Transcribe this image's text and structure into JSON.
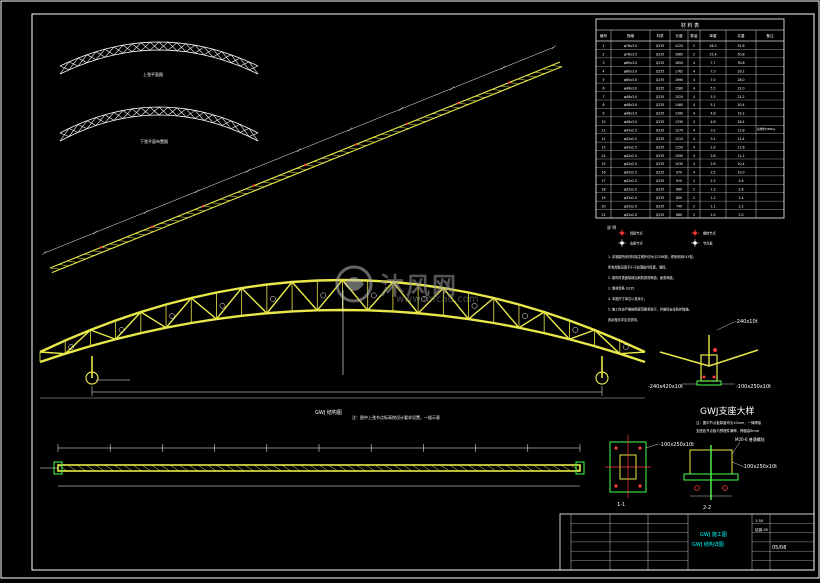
{
  "drawing": {
    "main_label": "GWJ 结构图",
    "main_note": "注：图中上弦节点标高按设计要求设置，一榀示意",
    "detail_title": "GWJ支座大样",
    "plan_label": "GWJ 平面图",
    "small_label_1": "上弦平面图",
    "small_label_2": "下弦平面布置图",
    "section_1": "1-1",
    "section_2": "2-2",
    "detail_callouts": [
      "-240x10t",
      "-240x420x10t",
      "-100x250x10t",
      "-100x250x10t",
      "-100x250x10t",
      "M20-6 普通螺栓"
    ],
    "detail_notes": [
      "注：图中节点板厚度均为10mm，一律焊接",
      "支座处节点板与预埋件满焊，焊缝高8mm"
    ]
  },
  "bom": {
    "title": "材  料  表",
    "headers": [
      "编号",
      "规格",
      "材质",
      "长度",
      "数量",
      "单重",
      "共重",
      "备注"
    ],
    "rows": [
      [
        "1",
        "φ76x3.5",
        "Q235",
        "4120",
        "2",
        "26.3",
        "52.6",
        ""
      ],
      [
        "2",
        "φ76x3.5",
        "Q235",
        "3985",
        "2",
        "25.4",
        "50.8",
        ""
      ],
      [
        "3",
        "φ60x3.0",
        "Q235",
        "1850",
        "4",
        "7.7",
        "30.8",
        ""
      ],
      [
        "4",
        "φ60x3.0",
        "Q235",
        "1762",
        "4",
        "7.3",
        "29.2",
        ""
      ],
      [
        "5",
        "φ60x3.0",
        "Q235",
        "1690",
        "4",
        "7.0",
        "28.0",
        ""
      ],
      [
        "6",
        "φ48x3.0",
        "Q235",
        "1580",
        "4",
        "5.5",
        "22.0",
        ""
      ],
      [
        "7",
        "φ48x3.0",
        "Q235",
        "1520",
        "4",
        "5.3",
        "21.2",
        ""
      ],
      [
        "8",
        "φ48x3.0",
        "Q235",
        "1460",
        "4",
        "5.1",
        "20.4",
        ""
      ],
      [
        "9",
        "φ48x3.0",
        "Q235",
        "1390",
        "4",
        "4.8",
        "19.2",
        ""
      ],
      [
        "10",
        "φ48x3.0",
        "Q235",
        "1330",
        "4",
        "4.6",
        "18.4",
        ""
      ],
      [
        "11",
        "φ42x2.5",
        "Q235",
        "1270",
        "4",
        "3.2",
        "12.8",
        ""
      ],
      [
        "12",
        "φ42x2.5",
        "Q235",
        "1210",
        "4",
        "3.1",
        "12.4",
        ""
      ],
      [
        "13",
        "φ42x2.5",
        "Q235",
        "1150",
        "4",
        "2.9",
        "11.6",
        ""
      ],
      [
        "14",
        "φ42x2.5",
        "Q235",
        "1090",
        "4",
        "2.8",
        "11.2",
        ""
      ],
      [
        "15",
        "φ42x2.5",
        "Q235",
        "1030",
        "4",
        "2.6",
        "10.4",
        ""
      ],
      [
        "16",
        "φ42x2.5",
        "Q235",
        "970",
        "4",
        "2.5",
        "10.0",
        ""
      ],
      [
        "17",
        "φ42x2.5",
        "Q235",
        "910",
        "2",
        "2.3",
        "4.6",
        ""
      ],
      [
        "18",
        "φ32x2.0",
        "Q235",
        "860",
        "2",
        "1.3",
        "2.6",
        ""
      ],
      [
        "19",
        "φ32x2.0",
        "Q235",
        "800",
        "2",
        "1.2",
        "2.4",
        ""
      ],
      [
        "20",
        "φ32x2.0",
        "Q235",
        "740",
        "2",
        "1.1",
        "2.2",
        ""
      ],
      [
        "21",
        "φ32x2.0",
        "Q235",
        "680",
        "2",
        "1.0",
        "2.0",
        ""
      ]
    ],
    "total_note": "总重约380kg"
  },
  "legend": {
    "title": "说  明",
    "items": [
      "焊接节点",
      "螺栓节点",
      "支座节点",
      "节点板"
    ],
    "notes": [
      "1. 本钢架所有材料除注明外均为Q235B钢，焊条采用E43型。",
      "   所有焊缝高度不小于较薄板件厚度，满焊。",
      "2. 钢构件表面除锈后刷防锈漆两道，面漆两道。",
      "3. 钢材焊条 Q235",
      "4. 本图尺寸单位以毫米计。",
      "5. 施工时应严格按照规范要求进行，并做好安全防护措施。",
      "   其余做法详见总说明。"
    ]
  },
  "title_block": {
    "project": "GWJ 施工图",
    "drawing_name": "GWJ 结构详图",
    "scale": "1:50",
    "sheet": "结施-05",
    "page": "05/08"
  },
  "watermark": {
    "text": "沐风网",
    "url": "www.mfcad.com"
  }
}
